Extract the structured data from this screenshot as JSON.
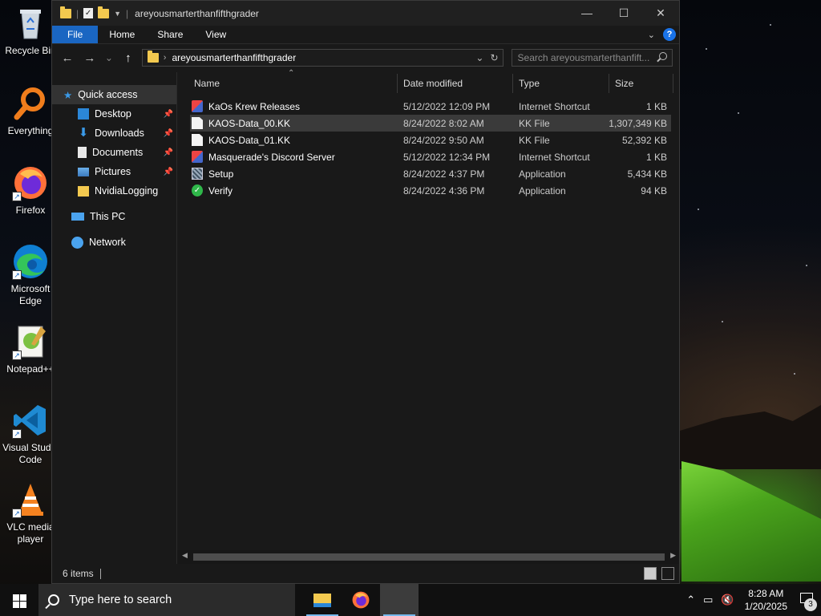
{
  "desktop": {
    "icons": [
      {
        "label": "Recycle Bin",
        "icon": "recycle-bin-icon"
      },
      {
        "label": "Everything",
        "icon": "everything-search-icon"
      },
      {
        "label": "Firefox",
        "icon": "firefox-icon"
      },
      {
        "label": "Microsoft Edge",
        "icon": "edge-icon"
      },
      {
        "label": "Notepad++",
        "icon": "notepadpp-icon"
      },
      {
        "label": "Visual Studio Code",
        "icon": "vscode-icon"
      },
      {
        "label": "VLC media player",
        "icon": "vlc-icon"
      }
    ]
  },
  "explorer": {
    "title": "areyousmarterthanfifthgrader",
    "ribbon_tabs": [
      "File",
      "Home",
      "Share",
      "View"
    ],
    "address_path": "areyousmarterthanfifthgrader",
    "search_placeholder": "Search areyousmarterthanfift...",
    "nav": {
      "quick_access": "Quick access",
      "pinned": [
        "Desktop",
        "Downloads",
        "Documents",
        "Pictures",
        "NvidiaLogging"
      ],
      "this_pc": "This PC",
      "network": "Network"
    },
    "columns": {
      "name": "Name",
      "date": "Date modified",
      "type": "Type",
      "size": "Size"
    },
    "files": [
      {
        "name": "KaOs Krew Releases",
        "date": "5/12/2022 12:09 PM",
        "type": "Internet Shortcut",
        "size": "1 KB",
        "icon": "internet-shortcut-icon"
      },
      {
        "name": "KAOS-Data_00.KK",
        "date": "8/24/2022 8:02 AM",
        "type": "KK File",
        "size": "1,307,349 KB",
        "icon": "file-icon"
      },
      {
        "name": "KAOS-Data_01.KK",
        "date": "8/24/2022 9:50 AM",
        "type": "KK File",
        "size": "52,392 KB",
        "icon": "file-icon"
      },
      {
        "name": "Masquerade's Discord Server",
        "date": "5/12/2022 12:34 PM",
        "type": "Internet Shortcut",
        "size": "1 KB",
        "icon": "internet-shortcut-icon"
      },
      {
        "name": "Setup",
        "date": "8/24/2022 4:37 PM",
        "type": "Application",
        "size": "5,434 KB",
        "icon": "setup-app-icon"
      },
      {
        "name": "Verify",
        "date": "8/24/2022 4:36 PM",
        "type": "Application",
        "size": "94 KB",
        "icon": "verify-check-icon"
      }
    ],
    "selected_file_index": 1,
    "status": "6 items"
  },
  "taskbar": {
    "search_placeholder": "Type here to search",
    "time": "8:28 AM",
    "date": "1/20/2025",
    "notification_count": "3"
  },
  "colors": {
    "accent": "#1a66c2",
    "window_bg": "#191919",
    "selection": "#3a3a3a",
    "folder": "#f3c94f"
  }
}
